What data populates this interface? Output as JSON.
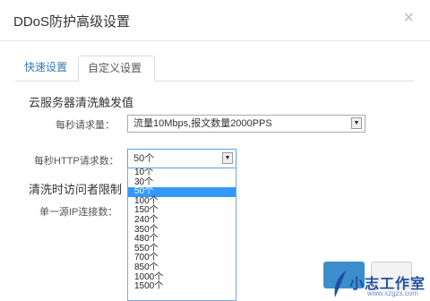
{
  "dialog": {
    "title": "DDoS防护高级设置",
    "close_icon": "×"
  },
  "tabs": [
    {
      "label": "快速设置"
    },
    {
      "label": "自定义设置"
    }
  ],
  "section1": {
    "title": "云服务器清洗触发值",
    "per_second_requests": {
      "label": "每秒请求量：",
      "value": "流量10Mbps,报文数量2000PPS"
    },
    "per_second_http": {
      "label": "每秒HTTP请求数：",
      "value": "50个"
    }
  },
  "section2": {
    "title": "清洗时访问者限制",
    "single_ip": {
      "label": "单一源IP连接数："
    }
  },
  "dropdown_options": [
    "10个",
    "30个",
    "50个",
    "100个",
    "150个",
    "240个",
    "350个",
    "480个",
    "550个",
    "700个",
    "850个",
    "1000个",
    "1500个"
  ],
  "selected_index": 2,
  "watermark": {
    "text": "小志工作室",
    "url": "www.xzgzs.com"
  },
  "colors": {
    "accent": "#3399ff",
    "primary_button": "#3c8dcb"
  }
}
